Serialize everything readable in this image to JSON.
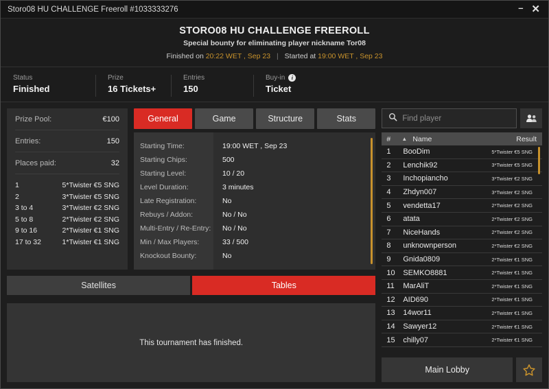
{
  "window": {
    "titlebar_text": "Storo08 HU CHALLENGE Freeroll #1033333276",
    "minimize_glyph": "–",
    "close_glyph": "✕"
  },
  "header": {
    "title": "STORO08 HU CHALLENGE FREEROLL",
    "subtitle": "Special bounty for eliminating player nickname Tor08",
    "finished_prefix": "Finished on",
    "finished_time": "20:22 WET , Sep 23",
    "divider": "|",
    "started_prefix": "Started at",
    "started_time": "19:00 WET , Sep 23"
  },
  "status_strip": [
    {
      "label": "Status",
      "value": "Finished",
      "info": false
    },
    {
      "label": "Prize",
      "value": "16 Tickets+",
      "info": false
    },
    {
      "label": "Entries",
      "value": "150",
      "info": false
    },
    {
      "label": "Buy-in",
      "value": "Ticket",
      "info": true,
      "info_glyph": "i"
    }
  ],
  "prize_panel": {
    "rows": [
      {
        "key": "Prize Pool:",
        "value": "€100"
      },
      {
        "key": "Entries:",
        "value": "150"
      },
      {
        "key": "Places paid:",
        "value": "32"
      }
    ],
    "payouts": [
      {
        "place": "1",
        "prize": "5*Twister €5 SNG"
      },
      {
        "place": "2",
        "prize": "3*Twister €5 SNG"
      },
      {
        "place": "3  to  4",
        "prize": "3*Twister €2 SNG"
      },
      {
        "place": "5  to  8",
        "prize": "2*Twister €2 SNG"
      },
      {
        "place": "9  to  16",
        "prize": "2*Twister €1 SNG"
      },
      {
        "place": "17  to  32",
        "prize": "1*Twister €1 SNG"
      }
    ]
  },
  "tabs": [
    {
      "label": "General",
      "active": true
    },
    {
      "label": "Game",
      "active": false
    },
    {
      "label": "Structure",
      "active": false
    },
    {
      "label": "Stats",
      "active": false
    }
  ],
  "general": {
    "rows": [
      {
        "label": "Starting Time:",
        "value": "19:00 WET , Sep 23"
      },
      {
        "label": "Starting Chips:",
        "value": "500"
      },
      {
        "label": "Starting Level:",
        "value": "10 / 20"
      },
      {
        "label": "Level Duration:",
        "value": "3 minutes"
      },
      {
        "label": "Late Registration:",
        "value": "No"
      },
      {
        "label": "Rebuys / Addon:",
        "value": "No / No"
      },
      {
        "label": "Multi-Entry / Re-Entry:",
        "value": "No / No"
      },
      {
        "label": "Min / Max Players:",
        "value": "33 / 500"
      },
      {
        "label": "Knockout Bounty:",
        "value": "No"
      }
    ]
  },
  "bottom_tabs": [
    {
      "label": "Satellites",
      "active": false
    },
    {
      "label": "Tables",
      "active": true
    }
  ],
  "bottom_panel": {
    "message": "This tournament has finished."
  },
  "player_search": {
    "placeholder": "Find player",
    "value": "",
    "search_icon": "search-icon",
    "people_icon": "people-icon"
  },
  "player_list": {
    "columns": {
      "num": "#",
      "sort_glyph": "▲",
      "name": "Name",
      "result": "Result"
    },
    "rows": [
      {
        "num": "1",
        "name": "BooDim",
        "result": "5*Twister €5 SNG"
      },
      {
        "num": "2",
        "name": "Lenchik92",
        "result": "3*Twister €5 SNG"
      },
      {
        "num": "3",
        "name": "Inchopiancho",
        "result": "3*Twister €2 SNG"
      },
      {
        "num": "4",
        "name": "Zhdyn007",
        "result": "3*Twister €2 SNG"
      },
      {
        "num": "5",
        "name": "vendetta17",
        "result": "2*Twister €2 SNG"
      },
      {
        "num": "6",
        "name": "atata",
        "result": "2*Twister €2 SNG"
      },
      {
        "num": "7",
        "name": "NiceHands",
        "result": "2*Twister €2 SNG"
      },
      {
        "num": "8",
        "name": "unknownperson",
        "result": "2*Twister €2 SNG"
      },
      {
        "num": "9",
        "name": "Gnida0809",
        "result": "2*Twister €1 SNG"
      },
      {
        "num": "10",
        "name": "SEMKO8881",
        "result": "2*Twister €1 SNG"
      },
      {
        "num": "11",
        "name": "MarAliT",
        "result": "2*Twister €1 SNG"
      },
      {
        "num": "12",
        "name": "AID690",
        "result": "2*Twister €1 SNG"
      },
      {
        "num": "13",
        "name": "14wor11",
        "result": "2*Twister €1 SNG"
      },
      {
        "num": "14",
        "name": "Sawyer12",
        "result": "2*Twister €1 SNG"
      },
      {
        "num": "15",
        "name": "chilly07",
        "result": "2*Twister €1 SNG"
      }
    ]
  },
  "footer": {
    "main_lobby_label": "Main Lobby",
    "favorite_icon": "star-icon"
  },
  "colors": {
    "accent_red": "#d92b24",
    "gold": "#c8922c",
    "panel": "#2e2e2e",
    "background": "#1e1e1e"
  }
}
